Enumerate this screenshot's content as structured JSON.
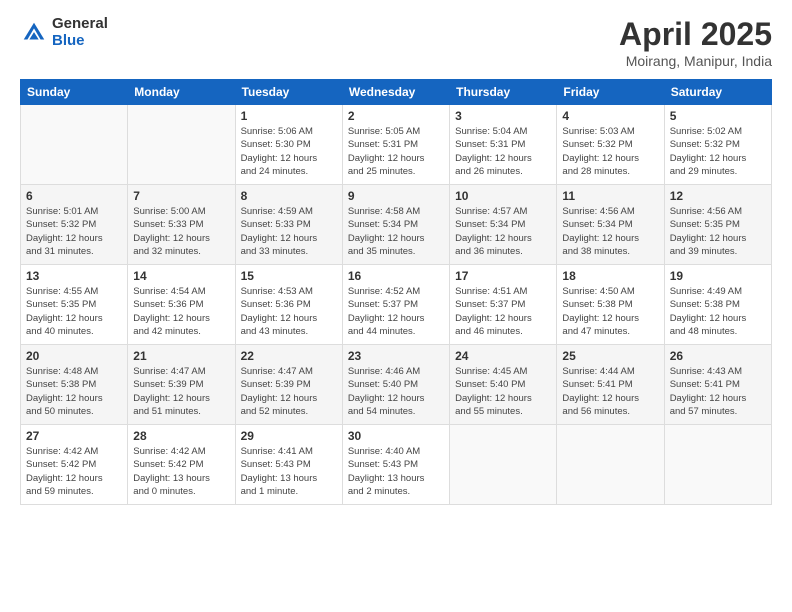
{
  "header": {
    "logo_general": "General",
    "logo_blue": "Blue",
    "month_title": "April 2025",
    "location": "Moirang, Manipur, India"
  },
  "days_of_week": [
    "Sunday",
    "Monday",
    "Tuesday",
    "Wednesday",
    "Thursday",
    "Friday",
    "Saturday"
  ],
  "weeks": [
    [
      {
        "day": "",
        "info": ""
      },
      {
        "day": "",
        "info": ""
      },
      {
        "day": "1",
        "info": "Sunrise: 5:06 AM\nSunset: 5:30 PM\nDaylight: 12 hours\nand 24 minutes."
      },
      {
        "day": "2",
        "info": "Sunrise: 5:05 AM\nSunset: 5:31 PM\nDaylight: 12 hours\nand 25 minutes."
      },
      {
        "day": "3",
        "info": "Sunrise: 5:04 AM\nSunset: 5:31 PM\nDaylight: 12 hours\nand 26 minutes."
      },
      {
        "day": "4",
        "info": "Sunrise: 5:03 AM\nSunset: 5:32 PM\nDaylight: 12 hours\nand 28 minutes."
      },
      {
        "day": "5",
        "info": "Sunrise: 5:02 AM\nSunset: 5:32 PM\nDaylight: 12 hours\nand 29 minutes."
      }
    ],
    [
      {
        "day": "6",
        "info": "Sunrise: 5:01 AM\nSunset: 5:32 PM\nDaylight: 12 hours\nand 31 minutes."
      },
      {
        "day": "7",
        "info": "Sunrise: 5:00 AM\nSunset: 5:33 PM\nDaylight: 12 hours\nand 32 minutes."
      },
      {
        "day": "8",
        "info": "Sunrise: 4:59 AM\nSunset: 5:33 PM\nDaylight: 12 hours\nand 33 minutes."
      },
      {
        "day": "9",
        "info": "Sunrise: 4:58 AM\nSunset: 5:34 PM\nDaylight: 12 hours\nand 35 minutes."
      },
      {
        "day": "10",
        "info": "Sunrise: 4:57 AM\nSunset: 5:34 PM\nDaylight: 12 hours\nand 36 minutes."
      },
      {
        "day": "11",
        "info": "Sunrise: 4:56 AM\nSunset: 5:34 PM\nDaylight: 12 hours\nand 38 minutes."
      },
      {
        "day": "12",
        "info": "Sunrise: 4:56 AM\nSunset: 5:35 PM\nDaylight: 12 hours\nand 39 minutes."
      }
    ],
    [
      {
        "day": "13",
        "info": "Sunrise: 4:55 AM\nSunset: 5:35 PM\nDaylight: 12 hours\nand 40 minutes."
      },
      {
        "day": "14",
        "info": "Sunrise: 4:54 AM\nSunset: 5:36 PM\nDaylight: 12 hours\nand 42 minutes."
      },
      {
        "day": "15",
        "info": "Sunrise: 4:53 AM\nSunset: 5:36 PM\nDaylight: 12 hours\nand 43 minutes."
      },
      {
        "day": "16",
        "info": "Sunrise: 4:52 AM\nSunset: 5:37 PM\nDaylight: 12 hours\nand 44 minutes."
      },
      {
        "day": "17",
        "info": "Sunrise: 4:51 AM\nSunset: 5:37 PM\nDaylight: 12 hours\nand 46 minutes."
      },
      {
        "day": "18",
        "info": "Sunrise: 4:50 AM\nSunset: 5:38 PM\nDaylight: 12 hours\nand 47 minutes."
      },
      {
        "day": "19",
        "info": "Sunrise: 4:49 AM\nSunset: 5:38 PM\nDaylight: 12 hours\nand 48 minutes."
      }
    ],
    [
      {
        "day": "20",
        "info": "Sunrise: 4:48 AM\nSunset: 5:38 PM\nDaylight: 12 hours\nand 50 minutes."
      },
      {
        "day": "21",
        "info": "Sunrise: 4:47 AM\nSunset: 5:39 PM\nDaylight: 12 hours\nand 51 minutes."
      },
      {
        "day": "22",
        "info": "Sunrise: 4:47 AM\nSunset: 5:39 PM\nDaylight: 12 hours\nand 52 minutes."
      },
      {
        "day": "23",
        "info": "Sunrise: 4:46 AM\nSunset: 5:40 PM\nDaylight: 12 hours\nand 54 minutes."
      },
      {
        "day": "24",
        "info": "Sunrise: 4:45 AM\nSunset: 5:40 PM\nDaylight: 12 hours\nand 55 minutes."
      },
      {
        "day": "25",
        "info": "Sunrise: 4:44 AM\nSunset: 5:41 PM\nDaylight: 12 hours\nand 56 minutes."
      },
      {
        "day": "26",
        "info": "Sunrise: 4:43 AM\nSunset: 5:41 PM\nDaylight: 12 hours\nand 57 minutes."
      }
    ],
    [
      {
        "day": "27",
        "info": "Sunrise: 4:42 AM\nSunset: 5:42 PM\nDaylight: 12 hours\nand 59 minutes."
      },
      {
        "day": "28",
        "info": "Sunrise: 4:42 AM\nSunset: 5:42 PM\nDaylight: 13 hours\nand 0 minutes."
      },
      {
        "day": "29",
        "info": "Sunrise: 4:41 AM\nSunset: 5:43 PM\nDaylight: 13 hours\nand 1 minute."
      },
      {
        "day": "30",
        "info": "Sunrise: 4:40 AM\nSunset: 5:43 PM\nDaylight: 13 hours\nand 2 minutes."
      },
      {
        "day": "",
        "info": ""
      },
      {
        "day": "",
        "info": ""
      },
      {
        "day": "",
        "info": ""
      }
    ]
  ]
}
